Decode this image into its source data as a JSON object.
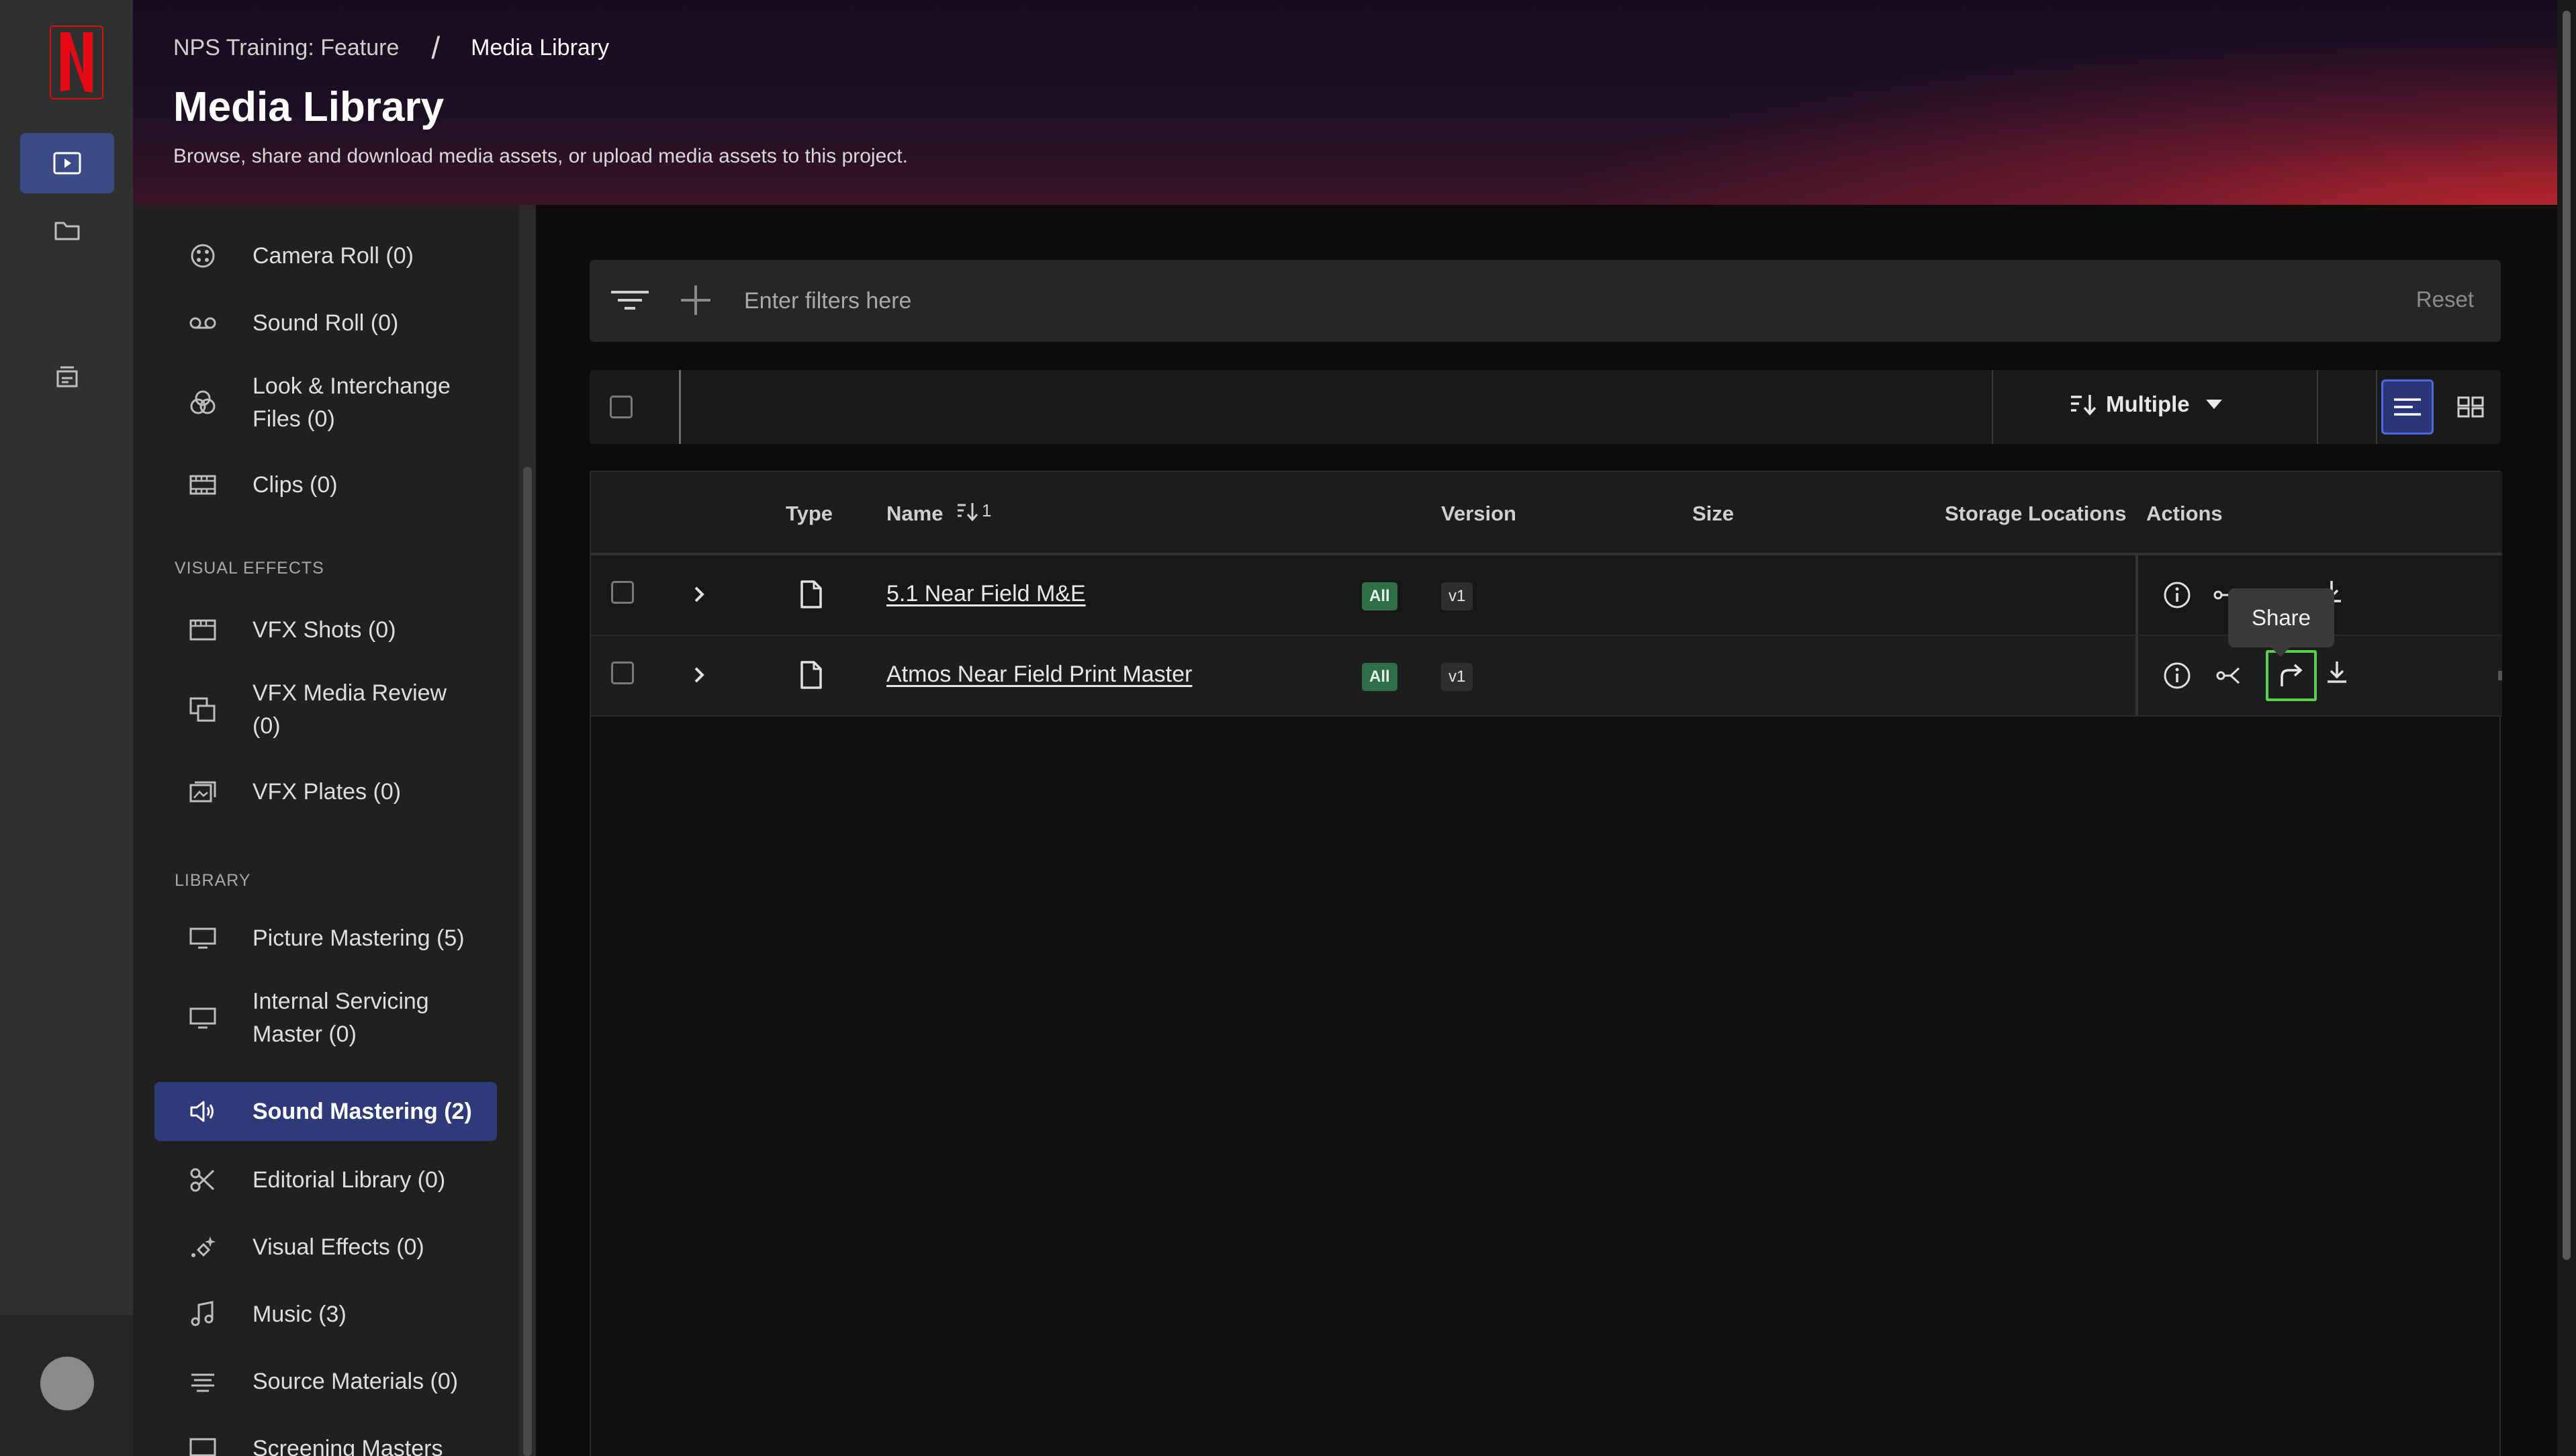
{
  "app": {
    "brand_logo": "netflix-n-logo"
  },
  "rail": {
    "items": [
      {
        "icon": "play-square-icon",
        "active": true
      },
      {
        "icon": "folder-icon",
        "active": false
      },
      {
        "icon": "inbox-stack-icon",
        "active": false
      }
    ]
  },
  "header": {
    "breadcrumb_project": "NPS Training: Feature",
    "breadcrumb_separator": "/",
    "breadcrumb_current": "Media Library",
    "title": "Media Library",
    "subtitle": "Browse, share and download media assets, or upload media assets to this project."
  },
  "sidebar": {
    "items": [
      {
        "label": "Camera Roll (0)",
        "icon": "film-reel-icon"
      },
      {
        "label": "Sound Roll (0)",
        "icon": "cassette-icon"
      },
      {
        "label": "Look & Interchange Files (0)",
        "label_line1": "Look & Interchange",
        "label_line2": "Files (0)",
        "icon": "color-circles-icon"
      },
      {
        "label": "Clips (0)",
        "icon": "film-strip-icon"
      }
    ],
    "section_vfx": "VISUAL EFFECTS",
    "vfx_items": [
      {
        "label": "VFX Shots (0)",
        "icon": "clapper-icon"
      },
      {
        "label": "VFX Media Review (0)",
        "label_line1": "VFX Media Review",
        "label_line2": "(0)",
        "icon": "review-icon"
      },
      {
        "label": "VFX Plates (0)",
        "icon": "plates-icon"
      }
    ],
    "section_library": "LIBRARY",
    "library_items": [
      {
        "label": "Picture Mastering (5)",
        "icon": "monitor-icon"
      },
      {
        "label": "Internal Servicing Master (0)",
        "label_line1": "Internal Servicing",
        "label_line2": "Master (0)",
        "icon": "monitor-icon"
      },
      {
        "label": "Sound Mastering (2)",
        "icon": "speaker-icon",
        "active": true
      },
      {
        "label": "Editorial Library (0)",
        "icon": "scissors-icon"
      },
      {
        "label": "Visual Effects (0)",
        "icon": "sparkle-icon"
      },
      {
        "label": "Music (3)",
        "icon": "music-note-icon"
      },
      {
        "label": "Source Materials (0)",
        "icon": "stack-icon"
      },
      {
        "label": "Screening Masters",
        "icon": "screen-icon"
      }
    ]
  },
  "filter": {
    "placeholder": "Enter filters here",
    "reset_label": "Reset"
  },
  "toolbar": {
    "sort_label": "Multiple",
    "view_mode": "list"
  },
  "table": {
    "columns": {
      "type": "Type",
      "name": "Name",
      "name_sort_rank": "1",
      "version": "Version",
      "size": "Size",
      "storage": "Storage Locations",
      "actions": "Actions"
    },
    "rows": [
      {
        "name": "5.1 Near Field M&E",
        "tag": "All",
        "version": "v1"
      },
      {
        "name": "Atmos Near Field Print Master",
        "tag": "All",
        "version": "v1"
      }
    ]
  },
  "tooltip": {
    "text": "Share"
  },
  "colors": {
    "accent": "#3c4a86",
    "active_nav": "#2f3a78",
    "tag_green": "#2f6e48",
    "focus_green": "#57d04c",
    "brand_red": "#e50914"
  }
}
